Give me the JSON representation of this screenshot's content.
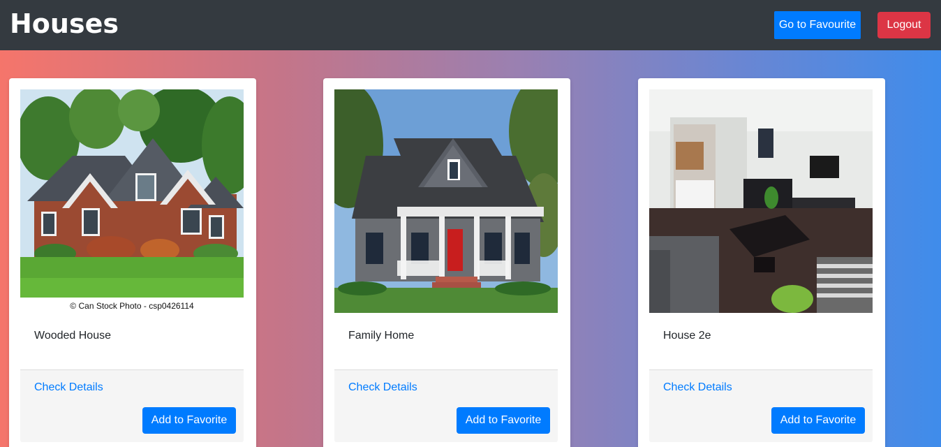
{
  "header": {
    "title": "Houses",
    "favourite_button": "Go to Favourite",
    "logout_button": "Logout"
  },
  "cards": [
    {
      "title": "Wooded House",
      "image_caption": "© Can Stock Photo - csp0426114",
      "details_link": "Check Details",
      "add_button": "Add to Favorite"
    },
    {
      "title": "Family Home",
      "details_link": "Check Details",
      "add_button": "Add to Favorite"
    },
    {
      "title": "House 2e",
      "details_link": "Check Details",
      "add_button": "Add to Favorite"
    }
  ],
  "colors": {
    "primary": "#007bff",
    "danger": "#dc3545",
    "navbar": "#343a40"
  }
}
